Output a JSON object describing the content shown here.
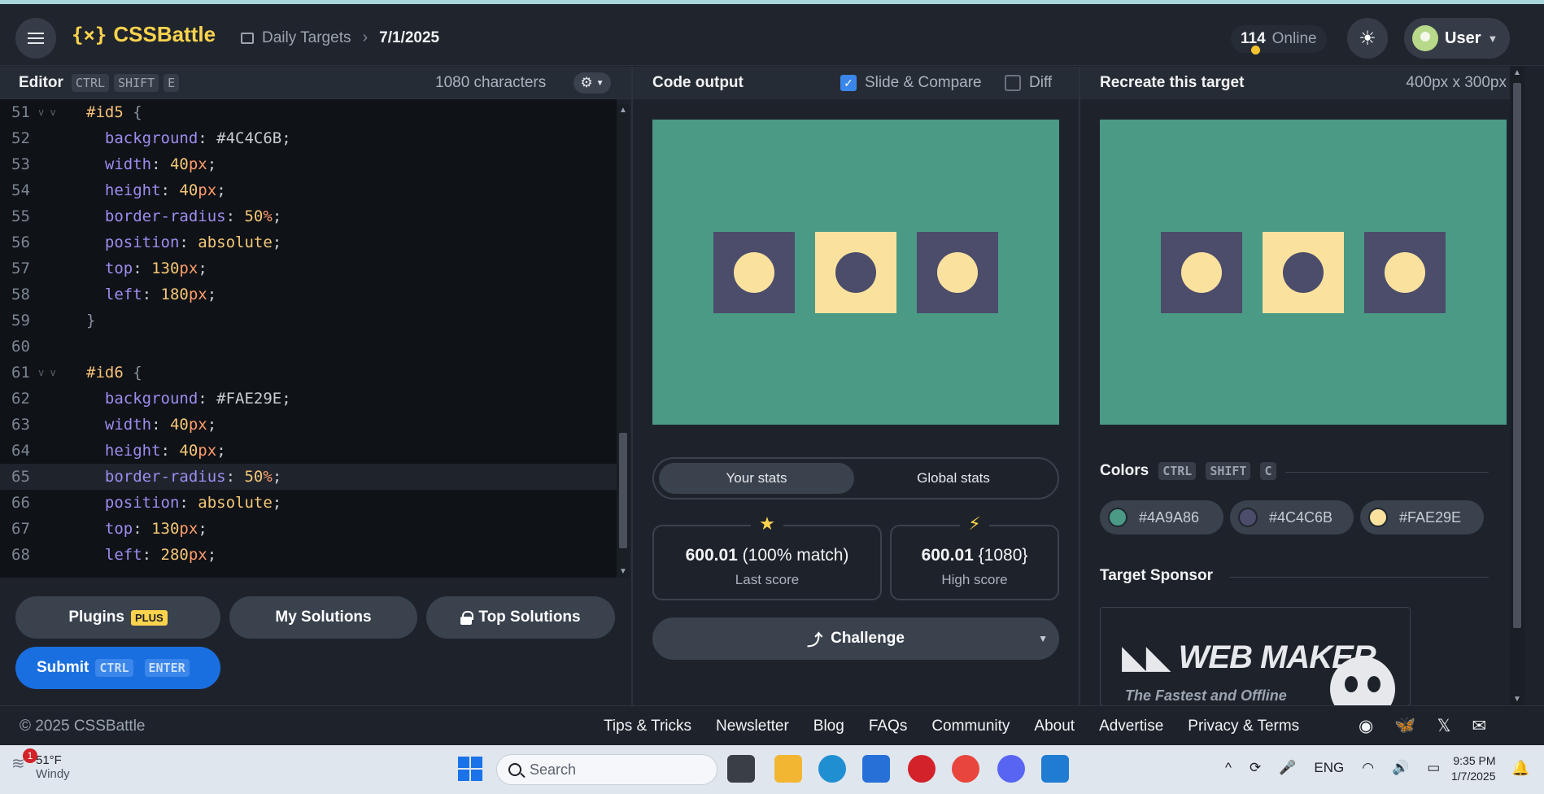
{
  "header": {
    "logo_mark": "{⨯}",
    "logo_text": "CSSBattle",
    "breadcrumb_parent": "Daily Targets",
    "breadcrumb_current": "7/1/2025",
    "online_count": "114",
    "online_label": "Online",
    "user_label": "User"
  },
  "editor": {
    "title": "Editor",
    "shortcut": [
      "CTRL",
      "SHIFT",
      "E"
    ],
    "chars": "1080 characters",
    "lines": [
      {
        "n": "51",
        "fold": true,
        "tokens": [
          [
            "sel",
            "#id5"
          ],
          [
            "brace",
            " {"
          ]
        ]
      },
      {
        "n": "52",
        "tokens": [
          [
            "prop",
            "  background"
          ],
          [
            "punc",
            ": "
          ],
          [
            "hex",
            "#4C4C6B"
          ],
          [
            "punc",
            ";"
          ]
        ]
      },
      {
        "n": "53",
        "tokens": [
          [
            "prop",
            "  width"
          ],
          [
            "punc",
            ": "
          ],
          [
            "num",
            "40"
          ],
          [
            "unit",
            "px"
          ],
          [
            "punc",
            ";"
          ]
        ]
      },
      {
        "n": "54",
        "tokens": [
          [
            "prop",
            "  height"
          ],
          [
            "punc",
            ": "
          ],
          [
            "num",
            "40"
          ],
          [
            "unit",
            "px"
          ],
          [
            "punc",
            ";"
          ]
        ]
      },
      {
        "n": "55",
        "tokens": [
          [
            "prop",
            "  border-radius"
          ],
          [
            "punc",
            ": "
          ],
          [
            "num",
            "50"
          ],
          [
            "unit",
            "%"
          ],
          [
            "punc",
            ";"
          ]
        ]
      },
      {
        "n": "56",
        "tokens": [
          [
            "prop",
            "  position"
          ],
          [
            "punc",
            ": "
          ],
          [
            "kw",
            "absolute"
          ],
          [
            "punc",
            ";"
          ]
        ]
      },
      {
        "n": "57",
        "tokens": [
          [
            "prop",
            "  top"
          ],
          [
            "punc",
            ": "
          ],
          [
            "num",
            "130"
          ],
          [
            "unit",
            "px"
          ],
          [
            "punc",
            ";"
          ]
        ]
      },
      {
        "n": "58",
        "tokens": [
          [
            "prop",
            "  left"
          ],
          [
            "punc",
            ": "
          ],
          [
            "num",
            "180"
          ],
          [
            "unit",
            "px"
          ],
          [
            "punc",
            ";"
          ]
        ]
      },
      {
        "n": "59",
        "tokens": [
          [
            "brace",
            "}"
          ]
        ]
      },
      {
        "n": "60",
        "tokens": []
      },
      {
        "n": "61",
        "fold": true,
        "tokens": [
          [
            "sel",
            "#id6"
          ],
          [
            "brace",
            " {"
          ]
        ]
      },
      {
        "n": "62",
        "tokens": [
          [
            "prop",
            "  background"
          ],
          [
            "punc",
            ": "
          ],
          [
            "hex",
            "#FAE29E"
          ],
          [
            "punc",
            ";"
          ]
        ]
      },
      {
        "n": "63",
        "tokens": [
          [
            "prop",
            "  width"
          ],
          [
            "punc",
            ": "
          ],
          [
            "num",
            "40"
          ],
          [
            "unit",
            "px"
          ],
          [
            "punc",
            ";"
          ]
        ]
      },
      {
        "n": "64",
        "tokens": [
          [
            "prop",
            "  height"
          ],
          [
            "punc",
            ": "
          ],
          [
            "num",
            "40"
          ],
          [
            "unit",
            "px"
          ],
          [
            "punc",
            ";"
          ]
        ]
      },
      {
        "n": "65",
        "active": true,
        "tokens": [
          [
            "prop",
            "  border-radius"
          ],
          [
            "punc",
            ": "
          ],
          [
            "num",
            "50"
          ],
          [
            "unit",
            "%"
          ],
          [
            "punc",
            ";"
          ]
        ]
      },
      {
        "n": "66",
        "tokens": [
          [
            "prop",
            "  position"
          ],
          [
            "punc",
            ": "
          ],
          [
            "kw",
            "absolute"
          ],
          [
            "punc",
            ";"
          ]
        ]
      },
      {
        "n": "67",
        "tokens": [
          [
            "prop",
            "  top"
          ],
          [
            "punc",
            ": "
          ],
          [
            "num",
            "130"
          ],
          [
            "unit",
            "px"
          ],
          [
            "punc",
            ";"
          ]
        ]
      },
      {
        "n": "68",
        "tokens": [
          [
            "prop",
            "  left"
          ],
          [
            "punc",
            ": "
          ],
          [
            "num",
            "280"
          ],
          [
            "unit",
            "px"
          ],
          [
            "punc",
            ";"
          ]
        ]
      }
    ],
    "plugins_label": "Plugins",
    "plugins_badge": "PLUS",
    "my_solutions_label": "My Solutions",
    "top_solutions_label": "Top Solutions",
    "submit_label": "Submit",
    "submit_shortcut": [
      "CTRL",
      "ENTER"
    ]
  },
  "output": {
    "title": "Code output",
    "slide_compare_label": "Slide & Compare",
    "slide_compare_checked": true,
    "diff_label": "Diff",
    "diff_checked": false,
    "tab_your": "Your stats",
    "tab_global": "Global stats",
    "last_score_value": "600.01",
    "last_score_detail": "(100% match)",
    "last_score_label": "Last score",
    "high_score_value": "600.01",
    "high_score_detail": "{1080}",
    "high_score_label": "High score",
    "challenge_label": "Challenge"
  },
  "target": {
    "title": "Recreate this target",
    "size": "400px x 300px",
    "colors_label": "Colors",
    "colors_shortcut": [
      "CTRL",
      "SHIFT",
      "C"
    ],
    "colors": [
      "#4A9A86",
      "#4C4C6B",
      "#FAE29E"
    ],
    "sponsor_label": "Target Sponsor",
    "sponsor_name": "WEB MAKER",
    "sponsor_tagline": "The Fastest and Offline"
  },
  "colors": {
    "bg": "#4A9A86",
    "dark": "#4C4C6B",
    "light": "#FAE29E"
  },
  "footer": {
    "copyright": "© 2025 CSSBattle",
    "links": [
      "Tips & Tricks",
      "Newsletter",
      "Blog",
      "FAQs",
      "Community",
      "About",
      "Advertise",
      "Privacy & Terms"
    ]
  },
  "taskbar": {
    "weather_temp": "51°F",
    "weather_desc": "Windy",
    "notification_count": "1",
    "search_placeholder": "Search",
    "lang": "ENG",
    "time": "9:35 PM",
    "date": "1/7/2025"
  }
}
